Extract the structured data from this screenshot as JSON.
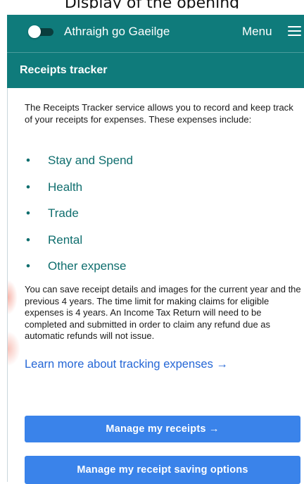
{
  "top_caption": "Display of the opening",
  "header": {
    "language_toggle_label": "Athraigh go Gaeilge",
    "menu_label": "Menu",
    "page_title": "Receipts tracker",
    "background_color": "#0f7b7b"
  },
  "intro_text": "The Receipts Tracker service allows you to record and keep track of your receipts for expenses. These expenses include:",
  "expenses": [
    {
      "bullet": "•",
      "label": "Stay and Spend"
    },
    {
      "bullet": "•",
      "label": "Health"
    },
    {
      "bullet": "•",
      "label": "Trade"
    },
    {
      "bullet": "•",
      "label": "Rental"
    },
    {
      "bullet": "•",
      "label": "Other expense"
    }
  ],
  "details_text": "You can save receipt details and images for the current year and the previous 4 years. The time limit for making claims for eligible expenses is 4 years. An Income Tax Return will need to be completed and submitted in order to claim any refund due as automatic refunds will not issue.",
  "learn_more_link": "Learn more about tracking expenses →",
  "buttons": {
    "manage_receipts": "Manage my receipts →",
    "saving_options": "Manage my receipt saving options"
  },
  "colors": {
    "accent": "#3a83ea",
    "list_text": "#0f6e6e",
    "link": "#2567d6"
  },
  "icons": {
    "toggle": "toggle-switch-icon",
    "menu": "hamburger-menu-icon"
  }
}
